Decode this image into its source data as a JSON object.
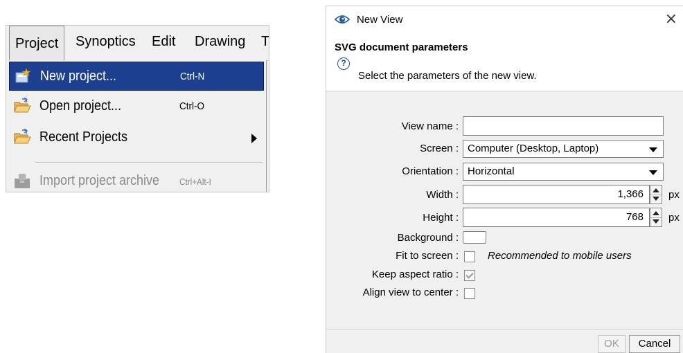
{
  "menubar": {
    "items": [
      "Project",
      "Synoptics",
      "Edit",
      "Drawing",
      "T"
    ]
  },
  "dropdown": {
    "items": [
      {
        "label": "New project...",
        "shortcut": "Ctrl-N",
        "icon": "new-project-icon",
        "selected": true,
        "enabled": true
      },
      {
        "label": "Open project...",
        "shortcut": "Ctrl-O",
        "icon": "open-folder-icon",
        "selected": false,
        "enabled": true
      },
      {
        "label": "Recent Projects",
        "shortcut": "",
        "icon": "open-folder-icon",
        "selected": false,
        "enabled": true,
        "submenu": true
      },
      {
        "label": "Import project archive",
        "shortcut": "Ctrl+Alt-I",
        "icon": "import-archive-icon",
        "selected": false,
        "enabled": false
      }
    ],
    "selected_color": "#1c3f8f"
  },
  "dialog": {
    "title": "New View",
    "close": "×",
    "header": {
      "heading": "SVG document parameters",
      "description": "Select the parameters of the new view.",
      "help_glyph": "?"
    },
    "form": {
      "view_name": {
        "label": "View name :",
        "value": ""
      },
      "screen": {
        "label": "Screen :",
        "value": "Computer (Desktop, Laptop)"
      },
      "orientation": {
        "label": "Orientation :",
        "value": "Horizontal"
      },
      "width": {
        "label": "Width :",
        "value": "1,366",
        "unit": "px"
      },
      "height": {
        "label": "Height :",
        "value": "768",
        "unit": "px"
      },
      "background": {
        "label": "Background :",
        "color": "#ffffff"
      },
      "fit_to_screen": {
        "label": "Fit to screen :",
        "checked": false,
        "hint": "Recommended to mobile users"
      },
      "keep_aspect_ratio": {
        "label": "Keep aspect ratio :",
        "checked": true,
        "enabled": false
      },
      "align_center": {
        "label": "Align view to center :",
        "checked": false
      }
    },
    "buttons": {
      "ok": "OK",
      "cancel": "Cancel"
    }
  }
}
